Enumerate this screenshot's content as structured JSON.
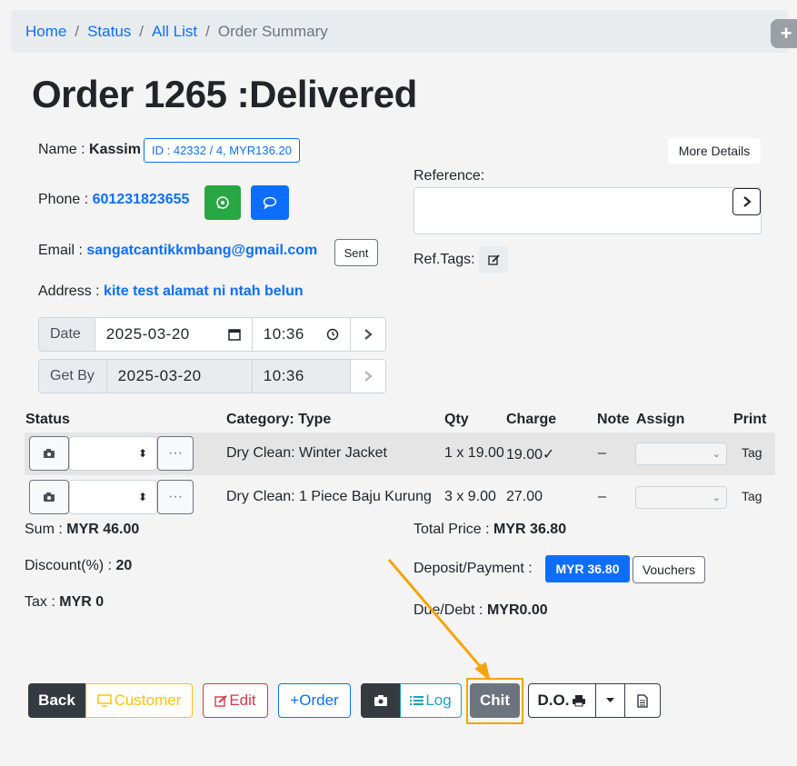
{
  "breadcrumb": {
    "home": "Home",
    "status": "Status",
    "all_list": "All List",
    "current": "Order Summary",
    "sep": "/"
  },
  "plus_icon": "+",
  "title": "Order 1265 :Delivered",
  "customer": {
    "name_label": "Name :",
    "name": "Kassim",
    "id_badge": "ID : 42332 / 4, MYR136.20",
    "phone_label": "Phone :",
    "phone": "601231823655",
    "email_label": "Email :",
    "email": "sangatcantikkmbang@gmail.com",
    "sent_label": "Sent",
    "address_label": "Address :",
    "address": "kite test alamat ni ntah belun"
  },
  "more_details": "More Details",
  "reference_label": "Reference:",
  "reference_value": "",
  "reftags_label": "Ref.Tags:",
  "date_row": {
    "label": "Date",
    "date": "2025-03-20",
    "time": "10:36"
  },
  "getby_row": {
    "label": "Get By",
    "date": "2025-03-20",
    "time": "10:36"
  },
  "table": {
    "headers": {
      "status": "Status",
      "category": "Category: Type",
      "qty": "Qty",
      "charge": "Charge",
      "note": "Note",
      "assign": "Assign",
      "print": "Print"
    },
    "rows": [
      {
        "category": "Dry Clean: Winter Jacket",
        "qty": "1 x 19.00",
        "charge": "19.00✓",
        "note": "–",
        "print": "Tag",
        "more": "···"
      },
      {
        "category": "Dry Clean: 1 Piece Baju Kurung",
        "qty": "3 x 9.00",
        "charge": "27.00",
        "note": "–",
        "print": "Tag",
        "more": "···"
      }
    ]
  },
  "summary": {
    "sum_label": "Sum :",
    "sum": "MYR 46.00",
    "discount_label": "Discount(%) :",
    "discount": "20",
    "tax_label": "Tax :",
    "tax": "MYR 0",
    "total_label": "Total Price :",
    "total": "MYR 36.80",
    "deposit_label": "Deposit/Payment :",
    "deposit": "MYR 36.80",
    "vouchers": "Vouchers",
    "due_label": "Due/Debt :",
    "due": "MYR0.00"
  },
  "actions": {
    "back": "Back",
    "customer": "Customer",
    "edit": "Edit",
    "order": "+Order",
    "log": "Log",
    "chit": "Chit",
    "do": "D.O."
  },
  "colors": {
    "primary": "#0d6efd",
    "success": "#28a745",
    "warning": "#ffc107",
    "danger": "#dc3545",
    "info": "#17a2b8",
    "dark": "#343a40",
    "secondary": "#6c757d",
    "highlight": "#f5a30a"
  }
}
